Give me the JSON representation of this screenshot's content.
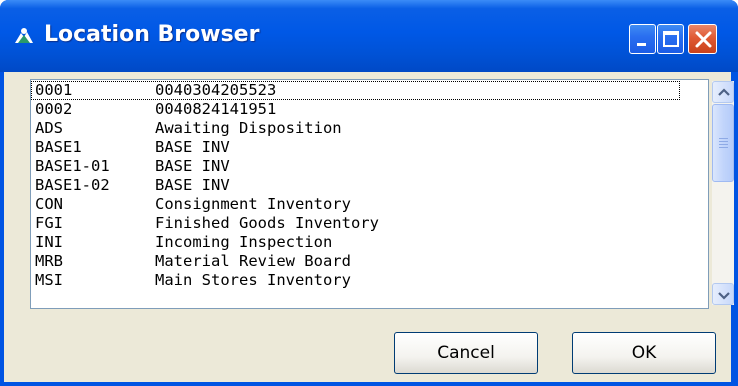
{
  "window": {
    "title": "Location Browser",
    "icon": "location-browser-icon",
    "controls": [
      "minimize-icon",
      "maximize-icon",
      "close-icon"
    ]
  },
  "list": {
    "focused_index": 0,
    "items": [
      {
        "code": "0001",
        "description": "0040304205523"
      },
      {
        "code": "0002",
        "description": "0040824141951"
      },
      {
        "code": "ADS",
        "description": "Awaiting Disposition"
      },
      {
        "code": "BASE1",
        "description": "BASE INV"
      },
      {
        "code": "BASE1-01",
        "description": "BASE INV"
      },
      {
        "code": "BASE1-02",
        "description": "BASE INV"
      },
      {
        "code": "CON",
        "description": "Consignment Inventory"
      },
      {
        "code": "FGI",
        "description": "Finished Goods Inventory"
      },
      {
        "code": "INI",
        "description": "Incoming Inspection"
      },
      {
        "code": "MRB",
        "description": "Material Review Board"
      },
      {
        "code": "MSI",
        "description": "Main Stores Inventory"
      }
    ]
  },
  "buttons": {
    "cancel_label": "Cancel",
    "ok_label": "OK"
  },
  "colors": {
    "titlebar": "#0058e6",
    "dialog_face": "#ece9d8",
    "close_button": "#e05a34"
  }
}
